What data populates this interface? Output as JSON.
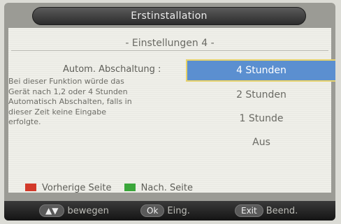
{
  "header": {
    "title": "Erstinstallation"
  },
  "page": {
    "subtitle": "- Einstellungen 4 -"
  },
  "setting": {
    "label": "Autom. Abschaltung :",
    "description_lines": [
      "Bei dieser Funktion würde das",
      "Gerät nach 1,2 oder 4 Stunden",
      "Automatisch Abschalten, falls in",
      "dieser Zeit keine Eingabe",
      "erfolgte."
    ]
  },
  "options": [
    "4 Stunden",
    "2 Stunden",
    "1 Stunde",
    "Aus"
  ],
  "selected_option": "4 Stunden",
  "legend": {
    "red_label": "Vorherige Seite",
    "green_label": "Nach. Seite"
  },
  "footer": {
    "nav_key": "▲▼",
    "nav_label": "bewegen",
    "ok_key": "Ok",
    "ok_label": "Eing.",
    "exit_key": "Exit",
    "exit_label": "Beend."
  },
  "colors": {
    "red": "#d23a2a",
    "green": "#3aa63a",
    "highlight": "#5b8fd0",
    "highlight_border": "#e8d36a"
  }
}
